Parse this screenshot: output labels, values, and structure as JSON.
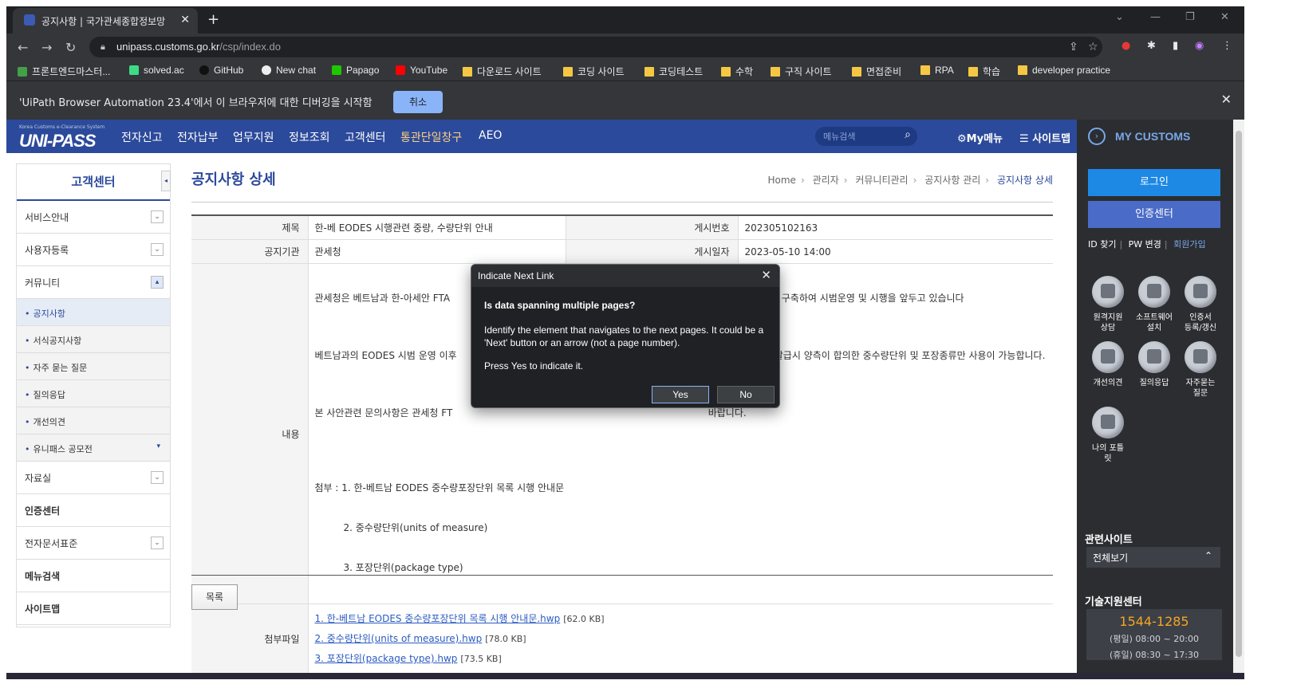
{
  "browser": {
    "tab_title": "공지사항 | 국가관세종합정보망",
    "url_host": "unipass.customs.go.kr",
    "url_path": "/csp/index.do",
    "bookmarks": [
      "프론트엔드마스터...",
      "solved.ac",
      "GitHub",
      "New chat",
      "Papago",
      "YouTube",
      "다운로드 사이트",
      "코딩 사이트",
      "코딩테스트",
      "수학",
      "구직 사이트",
      "면접준비",
      "RPA",
      "학습",
      "developer practice"
    ],
    "debug_message": "'UiPath Browser Automation 23.4'에서 이 브라우저에 대한 디버깅을 시작함",
    "debug_cancel": "취소"
  },
  "header": {
    "logo_small": "Korea Customs e-Clearance System",
    "logo": "UNI-PASS",
    "nav": [
      "전자신고",
      "전자납부",
      "업무지원",
      "정보조회",
      "고객센터",
      "통관단일창구",
      "AEO"
    ],
    "search_placeholder": "메뉴검색",
    "my_menu": "My메뉴",
    "sitemap": "사이트맵"
  },
  "right_panel": {
    "title": "MY CUSTOMS",
    "login": "로그인",
    "cert_center": "인증센터",
    "links": [
      "ID 찾기",
      "PW 변경",
      "회원가입"
    ],
    "quick_icons": [
      {
        "label_1": "원격지원",
        "label_2": "상담"
      },
      {
        "label_1": "소프트웨어",
        "label_2": "설치"
      },
      {
        "label_1": "인증서",
        "label_2": "등록/갱신"
      },
      {
        "label_1": "개선의견",
        "label_2": ""
      },
      {
        "label_1": "질의응답",
        "label_2": ""
      },
      {
        "label_1": "자주묻는",
        "label_2": "질문"
      },
      {
        "label_1": "나의 포틀",
        "label_2": "릿"
      }
    ],
    "related_title": "관련사이트",
    "related_select": "전체보기",
    "tech_title": "기술지원센터",
    "tech_phone": "1544-1285",
    "tech_weekday": "(평일) 08:00 ~ 20:00",
    "tech_holiday": "(휴일) 08:30 ~ 17:30"
  },
  "sidebar": {
    "title": "고객센터",
    "items": [
      "서비스안내",
      "사용자등록",
      "커뮤니티"
    ],
    "sub_items": [
      "공지사항",
      "서식공지사항",
      "자주 묻는 질문",
      "질의응답",
      "개선의견",
      "유니패스 공모전"
    ],
    "items_after": [
      "자료실",
      "인증센터",
      "전자문서표준",
      "메뉴검색",
      "사이트맵"
    ]
  },
  "page": {
    "title": "공지사항 상세",
    "breadcrumb": [
      "Home",
      "관리자",
      "커뮤니티관리",
      "공지사항 관리",
      "공지사항 상세"
    ],
    "labels": {
      "subject": "제목",
      "post_no": "게시번호",
      "agency": "공지기관",
      "post_date": "게시일자",
      "content": "내용",
      "attachments": "첨부파일"
    },
    "subject": "한-베 EODES 시행관련 중량, 수량단위 안내",
    "post_no": "202305102163",
    "agency": "관세청",
    "post_date": "2023-05-10 14:00",
    "content_p1": "관세청은 베트남과 한-아세안 FTA                                                                                        템'(EODES)을 구축하여 시범운영 및 시행을 앞두고 있습니다",
    "content_p2": "베트남과의 EODES 시범 운영 이후                                                                                      원산지증명서 발급시 양측이 합의한 중수량단위 및 포장종류만 사용이 가능합니다.",
    "content_p3": "본 사안관련 문의사항은 관세청 FT                                                                                    바랍니다.",
    "attach_line": "첨부 : 1. 한-베트남 EODES 중수량포장단위 목록 시행 안내문",
    "attach_2": "2. 중수량단위(units of measure)",
    "attach_3": "3. 포장단위(package type)",
    "files": [
      {
        "name": "1. 한-베트남 EODES 중수량포장단위 목록 시행 안내문.hwp",
        "size": "[62.0 KB]"
      },
      {
        "name": "2. 중수량단위(units of measure).hwp",
        "size": "[78.0 KB]"
      },
      {
        "name": "3. 포장단위(package type).hwp",
        "size": "[73.5 KB]"
      }
    ],
    "list_button": "목록"
  },
  "dialog": {
    "title": "Indicate Next Link",
    "question": "Is data spanning multiple pages?",
    "body": "Identify the element that navigates to the next pages. It could be a 'Next' button or an arrow (not a page number).",
    "body2": "Press Yes to indicate it.",
    "yes": "Yes",
    "no": "No"
  }
}
